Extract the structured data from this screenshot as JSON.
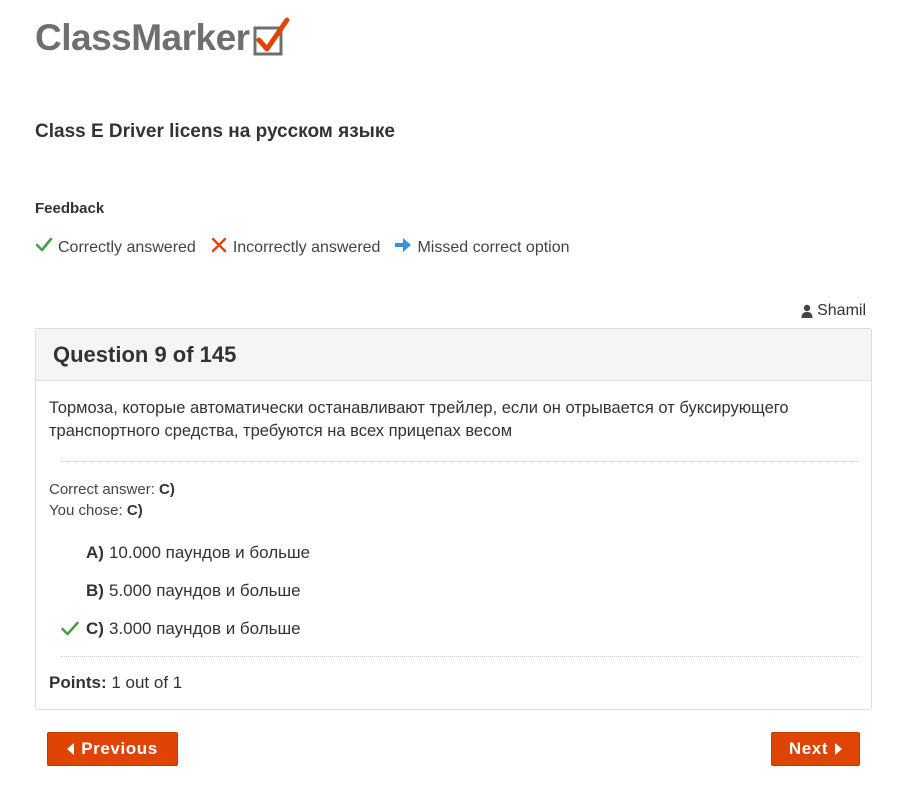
{
  "brand": {
    "logo_text": "ClassMarker",
    "logo_check_color": "#e04405"
  },
  "quiz": {
    "title": "Class E Driver licens на русском языке"
  },
  "feedback": {
    "label": "Feedback",
    "legend": [
      {
        "icon": "check-icon",
        "label": "Correctly answered",
        "color": "#43a047"
      },
      {
        "icon": "cross-icon",
        "label": "Incorrectly answered",
        "color": "#e04405"
      },
      {
        "icon": "arrow-right-icon",
        "label": "Missed correct option",
        "color": "#3d8ede"
      }
    ]
  },
  "user": {
    "name": "Shamil",
    "icon": "user-icon"
  },
  "question": {
    "header": "Question 9 of 145",
    "text": "Тормоза, которые автоматически останавливают трейлер, если он отрывается от буксирующего транспортного средства, требуются на всех прицепах весом",
    "correct_answer_label": "Correct answer:",
    "correct_answer_value": "C)",
    "you_chose_label": "You chose:",
    "you_chose_value": "C)",
    "options": [
      {
        "letter": "A)",
        "text": "10.000 паундов и больше",
        "marked_correct": false
      },
      {
        "letter": "B)",
        "text": "5.000 паундов и больше",
        "marked_correct": false
      },
      {
        "letter": "C)",
        "text": "3.000 паундов и больше",
        "marked_correct": true
      }
    ],
    "points_label": "Points:",
    "points_value": "1 out of 1"
  },
  "navigation": {
    "previous_label": "Previous",
    "next_label": "Next",
    "accent": "#e04405"
  }
}
